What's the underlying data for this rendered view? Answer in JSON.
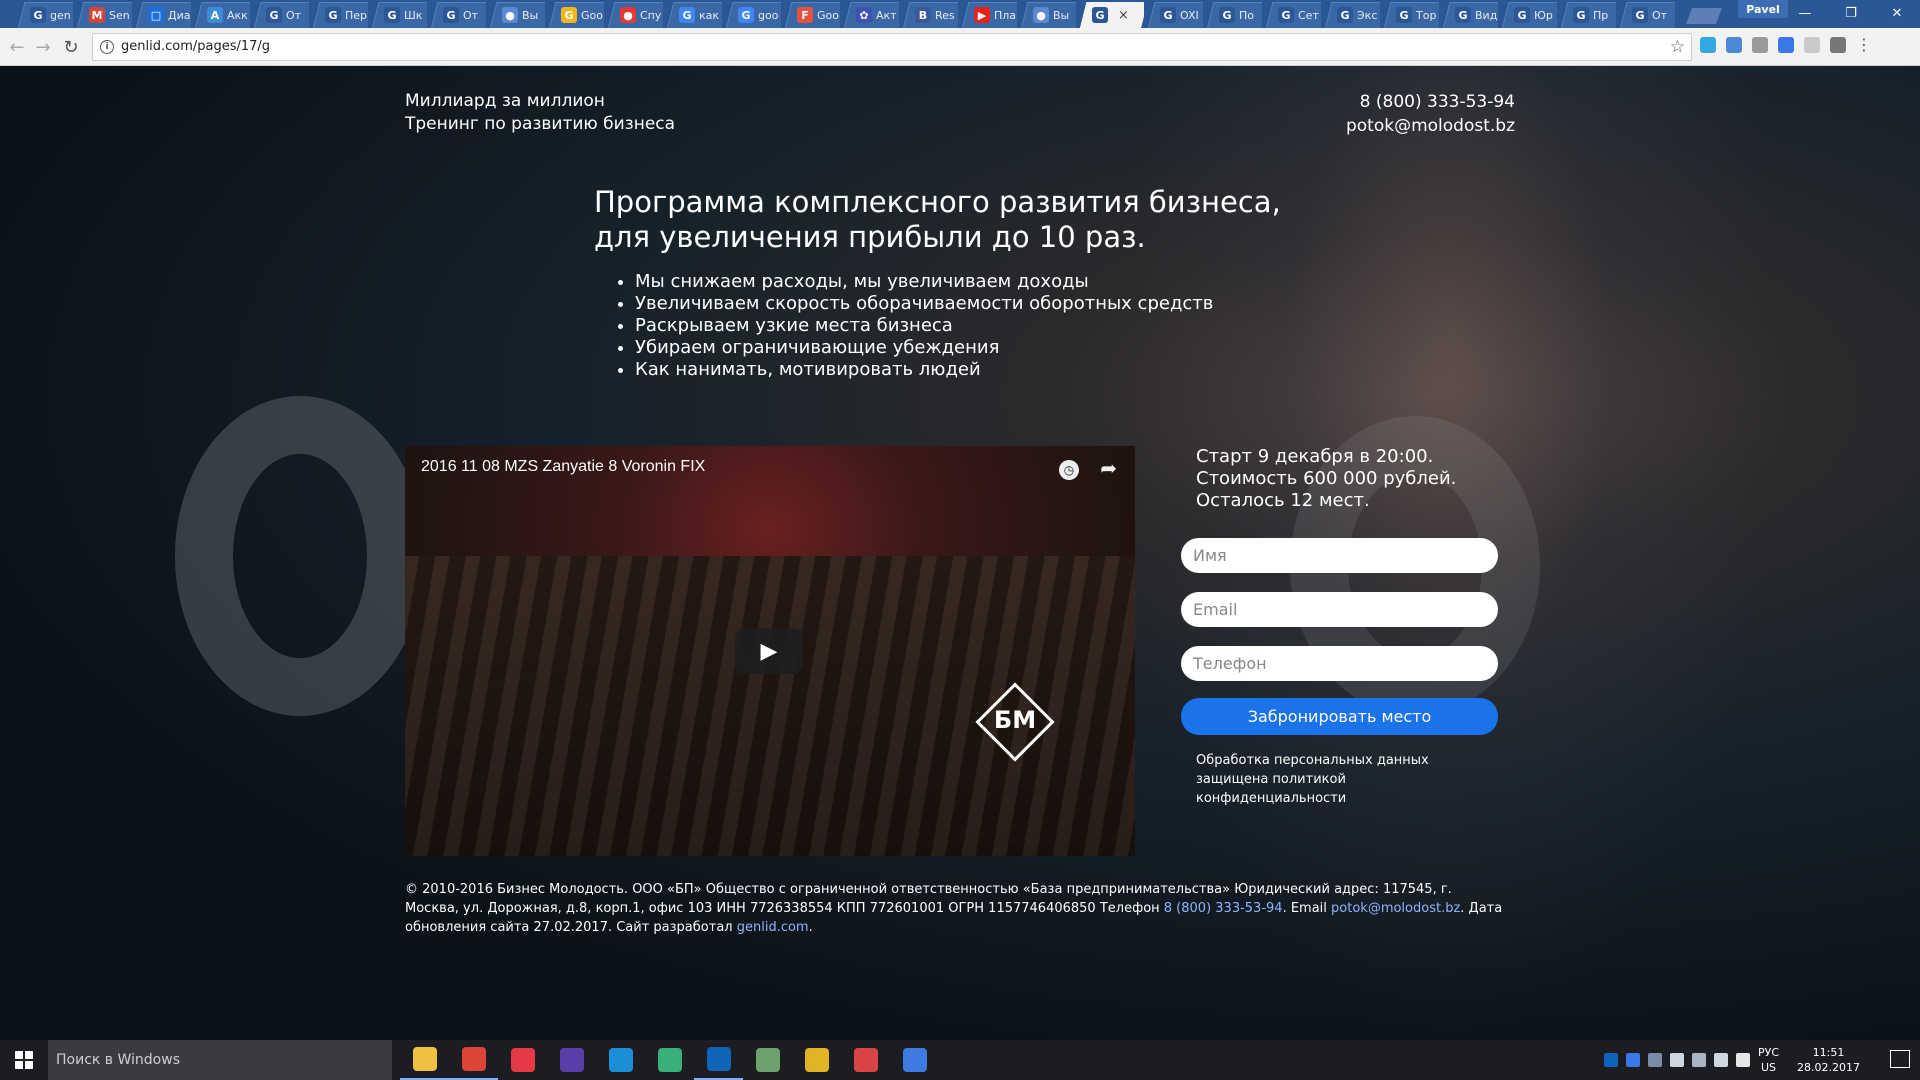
{
  "browser": {
    "tabs": [
      {
        "label": "gen",
        "color": "#2b5797",
        "glyph": "G"
      },
      {
        "label": "Sen",
        "color": "#d44638",
        "glyph": "M"
      },
      {
        "label": "Диа",
        "color": "#1e6fd9",
        "glyph": "□"
      },
      {
        "label": "Акк",
        "color": "#3b8ed6",
        "glyph": "A"
      },
      {
        "label": "От",
        "color": "#2b5797",
        "glyph": "G"
      },
      {
        "label": "Пер",
        "color": "#2b5797",
        "glyph": "G"
      },
      {
        "label": "Шк",
        "color": "#2b5797",
        "glyph": "G"
      },
      {
        "label": "От",
        "color": "#2b5797",
        "glyph": "G"
      },
      {
        "label": "Вы",
        "color": "#5a8ad0",
        "glyph": "●"
      },
      {
        "label": "Goo",
        "color": "#f2b51a",
        "glyph": "G"
      },
      {
        "label": "Спу",
        "color": "#e53935",
        "glyph": "●"
      },
      {
        "label": "как",
        "color": "#4285f4",
        "glyph": "G"
      },
      {
        "label": "goo",
        "color": "#4285f4",
        "glyph": "G"
      },
      {
        "label": "Goo",
        "color": "#e5533c",
        "glyph": "F"
      },
      {
        "label": "Акт",
        "color": "#3f51b5",
        "glyph": "✿"
      },
      {
        "label": "Res",
        "color": "#3b5998",
        "glyph": "B"
      },
      {
        "label": "Пла",
        "color": "#e62117",
        "glyph": "▶"
      },
      {
        "label": "Вы",
        "color": "#5a8ad0",
        "glyph": "●"
      },
      {
        "label": "",
        "color": "#2b5797",
        "glyph": "G"
      },
      {
        "label": "OXI",
        "color": "#2b5797",
        "glyph": "G"
      },
      {
        "label": "По",
        "color": "#2b5797",
        "glyph": "G"
      },
      {
        "label": "Сет",
        "color": "#2b5797",
        "glyph": "G"
      },
      {
        "label": "Экс",
        "color": "#2b5797",
        "glyph": "G"
      },
      {
        "label": "Тор",
        "color": "#2b5797",
        "glyph": "G"
      },
      {
        "label": "Вид",
        "color": "#2b5797",
        "glyph": "G"
      },
      {
        "label": "Юр",
        "color": "#2b5797",
        "glyph": "G"
      },
      {
        "label": "Пр",
        "color": "#2b5797",
        "glyph": "G"
      },
      {
        "label": "От",
        "color": "#2b5797",
        "glyph": "G"
      }
    ],
    "active_tab_index": 18,
    "user": "Pavel",
    "url": "genlid.com/pages/17/g",
    "extension_colors": [
      "#35a7e0",
      "#4d8ad6",
      "#9a9a9a",
      "#3b78e7",
      "#c9c9c9",
      "#777777"
    ]
  },
  "page": {
    "brand_title": "Миллиард за миллион",
    "brand_subtitle": "Тренинг по развитию бизнеса",
    "phone": "8 (800) 333-53-94",
    "email": "potok@molodost.bz",
    "headline_line1": "Программа комплексного развития бизнеса,",
    "headline_line2": "для увеличения прибыли до 10 раз.",
    "bullets": [
      "Мы снижаем расходы, мы увеличиваем доходы",
      "Увеличиваем скорость оборачиваемости оборотных средств",
      "Раскрываем узкие места бизнеса",
      "Убираем ограничивающие убеждения",
      "Как нанимать, мотивировать людей"
    ],
    "video": {
      "title": "2016 11 08 MZS Zanyatie 8 Voronin FIX",
      "logo_text": "БМ"
    },
    "offer": {
      "line1": "Старт 9 декабря в 20:00.",
      "line2": "Стоимость 600 000 рублей.",
      "line3": "Осталось 12 мест."
    },
    "form": {
      "name_placeholder": "Имя",
      "email_placeholder": "Email",
      "phone_placeholder": "Телефон",
      "submit_label": "Забронировать место",
      "privacy_line1": "Обработка персональных данных",
      "privacy_line2": "защищена политикой",
      "privacy_line3": "конфиденциальности"
    },
    "footer": {
      "text_part1": "© 2010-2016 Бизнес Молодость. ООО «БП» Общество с ограниченной ответственностью «База предпринимательства» Юридический адрес: 117545, г. Москва, ул. Дорожная, д.8, корп.1, офис 103 ИНН 7726338554 КПП 772601001 ОГРН 1157746406850 Телефон ",
      "phone_link": "8 (800) 333-53-94",
      "text_part2": ". Email ",
      "email_link": "potok@molodost.bz",
      "text_part3": ". Дата обновления сайта 27.02.2017. Сайт разработал ",
      "dev_link": "genlid.com",
      "text_part4": "."
    }
  },
  "taskbar": {
    "search_placeholder": "Поиск в Windows",
    "apps": [
      {
        "name": "file-explorer-icon",
        "color": "#f0c040",
        "running": true
      },
      {
        "name": "chrome-icon",
        "color": "#db4437",
        "running": true
      },
      {
        "name": "red-app-icon",
        "color": "#e53945",
        "running": false
      },
      {
        "name": "purple-app-icon",
        "color": "#5b3fa8",
        "running": false
      },
      {
        "name": "edge-icon",
        "color": "#1b8ed6",
        "running": false
      },
      {
        "name": "green-app-icon",
        "color": "#39b07a",
        "running": false
      },
      {
        "name": "outlook-icon",
        "color": "#0f64b8",
        "running": true
      },
      {
        "name": "network-app-icon",
        "color": "#6ca36c",
        "running": false
      },
      {
        "name": "yellow-red-app-icon",
        "color": "#e2b324",
        "running": false
      },
      {
        "name": "gift-app-icon",
        "color": "#d94545",
        "running": false
      },
      {
        "name": "a-app-icon",
        "color": "#3d7be0",
        "running": false
      }
    ],
    "lang_line1": "РУС",
    "lang_line2": "US",
    "time": "11:51",
    "date": "28.02.2017"
  }
}
